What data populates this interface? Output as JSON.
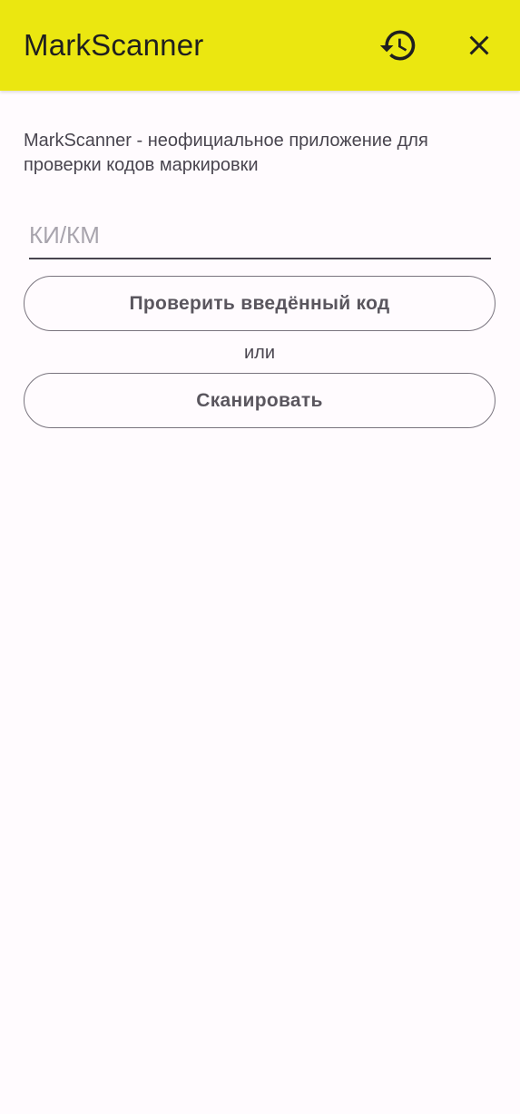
{
  "app_bar": {
    "title": "MarkScanner",
    "background_color": "#ebe710",
    "actions": [
      {
        "icon": "history-icon"
      },
      {
        "icon": "close-icon"
      }
    ]
  },
  "main": {
    "description": "MarkScanner - неофициальное приложение для проверки кодов маркировки",
    "code_input": {
      "placeholder": "КИ/КМ",
      "value": ""
    },
    "check_button_label": "Проверить введённый код",
    "or_label": "или",
    "scan_button_label": "Сканировать"
  }
}
